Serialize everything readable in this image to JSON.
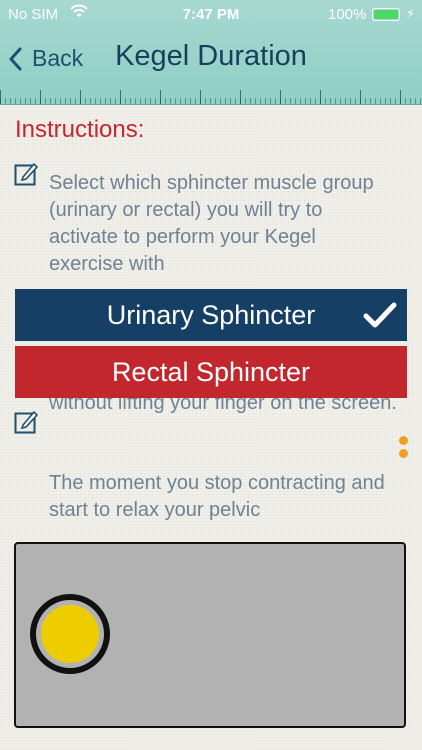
{
  "status_bar": {
    "carrier": "No SIM",
    "time": "7:47 PM",
    "battery_percent": "100%",
    "battery_level": 1.0,
    "battery_color": "#4cd964"
  },
  "nav": {
    "back_label": "Back",
    "back_icon": "chevron-left-icon",
    "title": "Kegel Duration"
  },
  "instructions": {
    "title": "Instructions:",
    "step1": "Select which sphincter muscle group (urinary or rectal) you will try to activate to perform your Kegel exercise with",
    "step2": "without lifting your finger on the screen.",
    "step3": "The moment you stop contracting and start to relax your pelvic",
    "step_icon": "edit-note-icon"
  },
  "options": [
    {
      "label": "Urinary Sphincter",
      "selected": true,
      "color": "#163f66"
    },
    {
      "label": "Rectal Sphincter",
      "selected": false,
      "color": "#c1272d"
    }
  ],
  "colors": {
    "header": "#9ad3ca",
    "title_text": "#163f5e",
    "instructions_title": "#c7262e",
    "body_text": "#6e8294",
    "page_dots": "#f0a020",
    "pad": "#b2b2b2",
    "knob": "#eecd00"
  }
}
